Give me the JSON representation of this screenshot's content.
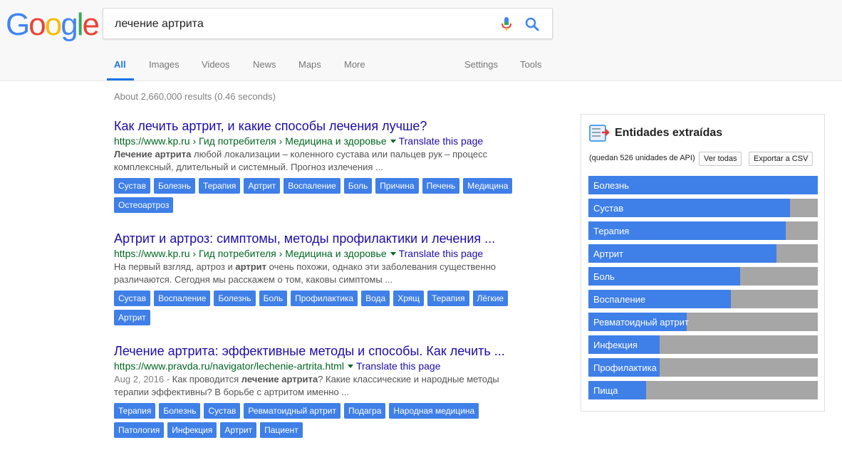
{
  "logo": {
    "letters": [
      "G",
      "o",
      "o",
      "g",
      "l",
      "e"
    ],
    "colors": [
      "#4285F4",
      "#EA4335",
      "#FBBC05",
      "#4285F4",
      "#34A853",
      "#EA4335"
    ]
  },
  "search": {
    "query": "лечение артрита"
  },
  "tabs": [
    {
      "label": "All",
      "active": true
    },
    {
      "label": "Images"
    },
    {
      "label": "Videos"
    },
    {
      "label": "News"
    },
    {
      "label": "Maps"
    },
    {
      "label": "More"
    },
    {
      "label": "Settings"
    },
    {
      "label": "Tools"
    }
  ],
  "stats": "About 2,660,000 results (0.46 seconds)",
  "results": [
    {
      "title": "Как лечить артрит, и какие способы лечения лучше?",
      "url": "https://www.kp.ru › Гид потребителя › Медицина и здоровье",
      "translate": "Translate this page",
      "date": "",
      "snippet_parts": [
        {
          "t": "Лечение артрита",
          "b": true
        },
        {
          "t": " любой локализации – коленного сустава или пальцев рук – процесс комплексный, длительный и системный. Прогноз излечения ...",
          "b": false
        }
      ],
      "chips": [
        "Сустав",
        "Болезнь",
        "Терапия",
        "Артрит",
        "Воспаление",
        "Боль",
        "Причина",
        "Печень",
        "Медицина",
        "Остеоартроз"
      ]
    },
    {
      "title": "Артрит и артроз: симптомы, методы профилактики и лечения ...",
      "url": "https://www.kp.ru › Гид потребителя › Медицина и здоровье",
      "translate": "Translate this page",
      "date": "",
      "snippet_parts": [
        {
          "t": "На первый взгляд, артроз и ",
          "b": false
        },
        {
          "t": "артрит",
          "b": true
        },
        {
          "t": " очень похожи, однако эти заболевания существенно различаются. Сегодня мы расскажем о том, каковы симптомы ...",
          "b": false
        }
      ],
      "chips": [
        "Сустав",
        "Воспаление",
        "Болезнь",
        "Боль",
        "Профилактика",
        "Вода",
        "Хрящ",
        "Терапия",
        "Лёгкие",
        "Артрит"
      ]
    },
    {
      "title": "Лечение артрита: эффективные методы и способы. Как лечить ...",
      "url": "https://www.pravda.ru/navigator/lechenie-artrita.html",
      "translate": "Translate this page",
      "date": "Aug 2, 2016 - ",
      "snippet_parts": [
        {
          "t": "Как проводится ",
          "b": false
        },
        {
          "t": "лечение артрита",
          "b": true
        },
        {
          "t": "? Какие классические и народные методы терапии эффективны? В борьбе с артритом именно ...",
          "b": false
        }
      ],
      "chips": [
        "Терапия",
        "Болезнь",
        "Сустав",
        "Ревматоидный артрит",
        "Подагра",
        "Народная медицина",
        "Патология",
        "Инфекция",
        "Артрит",
        "Пациент"
      ]
    }
  ],
  "panel": {
    "title": "Entidades extraídas",
    "quota": "(quedan 526 unidades de API)",
    "view_all": "Ver todas",
    "export": "Exportar a CSV",
    "icon_colors": {
      "accent": "#e53935",
      "screen": "#1e88e5"
    },
    "entities": [
      {
        "label": "Болезнь",
        "score": 1.0
      },
      {
        "label": "Сустав",
        "score": 0.88
      },
      {
        "label": "Терапия",
        "score": 0.86
      },
      {
        "label": "Артрит",
        "score": 0.82
      },
      {
        "label": "Боль",
        "score": 0.66
      },
      {
        "label": "Воспаление",
        "score": 0.62
      },
      {
        "label": "Ревматоидный артрит",
        "score": 0.43
      },
      {
        "label": "Инфекция",
        "score": 0.31
      },
      {
        "label": "Профилактика",
        "score": 0.31
      },
      {
        "label": "Пища",
        "score": 0.25
      }
    ]
  }
}
